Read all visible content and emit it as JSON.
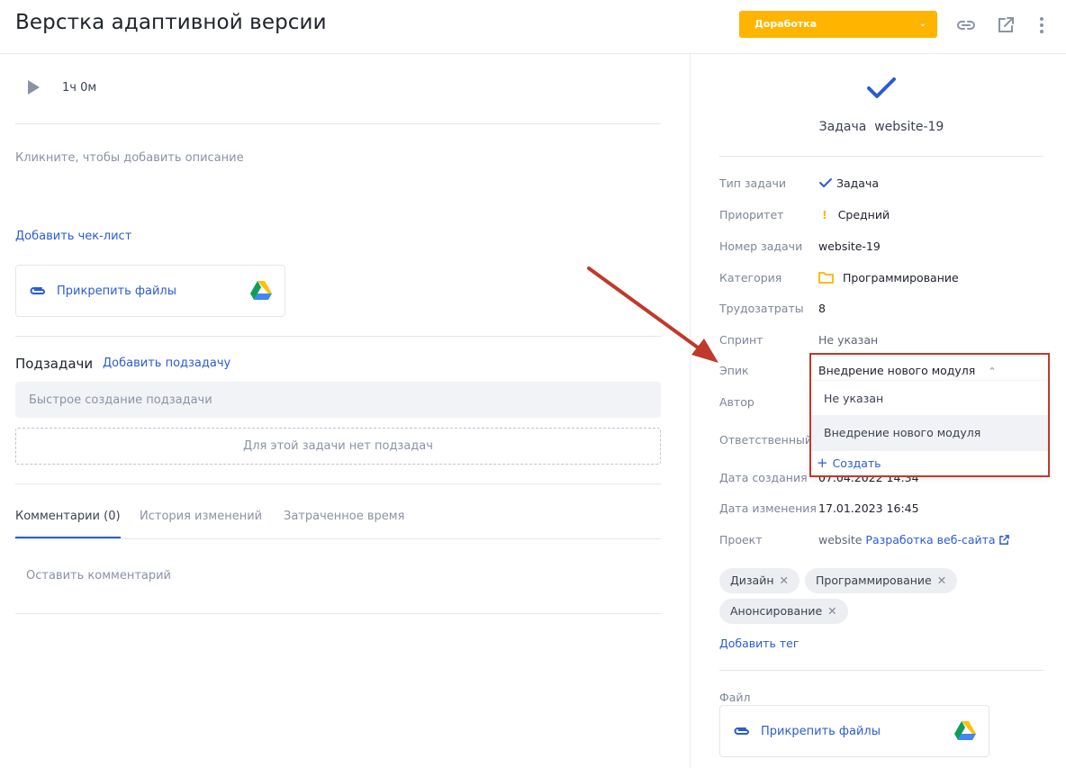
{
  "header": {
    "title": "Верстка адаптивной версии",
    "status": "Доработка",
    "status_color": "#ffb400",
    "icons": [
      "link-icon",
      "external-link-icon",
      "more-vertical-icon"
    ]
  },
  "timer": {
    "value": "1ч 0м"
  },
  "description": {
    "placeholder": "Кликните, чтобы добавить описание"
  },
  "checklist": {
    "add_label": "Добавить чек-лист"
  },
  "attach": {
    "label": "Прикрепить файлы"
  },
  "subtasks": {
    "heading": "Подзадачи",
    "add_label": "Добавить подзадачу",
    "quick_placeholder": "Быстрое создание подзадачи",
    "empty": "Для этой задачи нет подзадач"
  },
  "tabs": [
    {
      "label": "Комментарии (0)",
      "active": true
    },
    {
      "label": "История изменений",
      "active": false
    },
    {
      "label": "Затраченное время",
      "active": false
    }
  ],
  "comment": {
    "placeholder": "Оставить комментарий"
  },
  "task": {
    "type_word": "Задача",
    "code": "website-19"
  },
  "props": {
    "type": {
      "label": "Тип задачи",
      "value": "Задача"
    },
    "priority": {
      "label": "Приоритет",
      "value": "Средний"
    },
    "number": {
      "label": "Номер задачи",
      "value": "website-19"
    },
    "category": {
      "label": "Категория",
      "value": "Программирование"
    },
    "effort": {
      "label": "Трудозатраты",
      "value": "8"
    },
    "sprint": {
      "label": "Спринт",
      "value": "Не указан"
    },
    "epic": {
      "label": "Эпик",
      "value": "Внедрение нового модуля"
    },
    "author": {
      "label": "Автор"
    },
    "assignee": {
      "label": "Ответственный"
    },
    "created": {
      "label": "Дата создания",
      "value": "07.04.2022 14:34"
    },
    "modified": {
      "label": "Дата изменения",
      "value": "17.01.2023 16:45"
    },
    "project": {
      "label": "Проект",
      "key": "website",
      "name": "Разработка веб-сайта"
    }
  },
  "epic_dropdown": {
    "options": [
      "Не указан",
      "Внедрение нового модуля"
    ],
    "selected_index": 1,
    "create_label": "Создать"
  },
  "tags": [
    "Дизайн",
    "Программирование",
    "Анонсирование"
  ],
  "add_tag": "Добавить тег",
  "file": {
    "label": "Файл",
    "attach_label": "Прикрепить файлы"
  },
  "colors": {
    "accent": "#2a5bd7",
    "highlight": "#c0392b"
  }
}
